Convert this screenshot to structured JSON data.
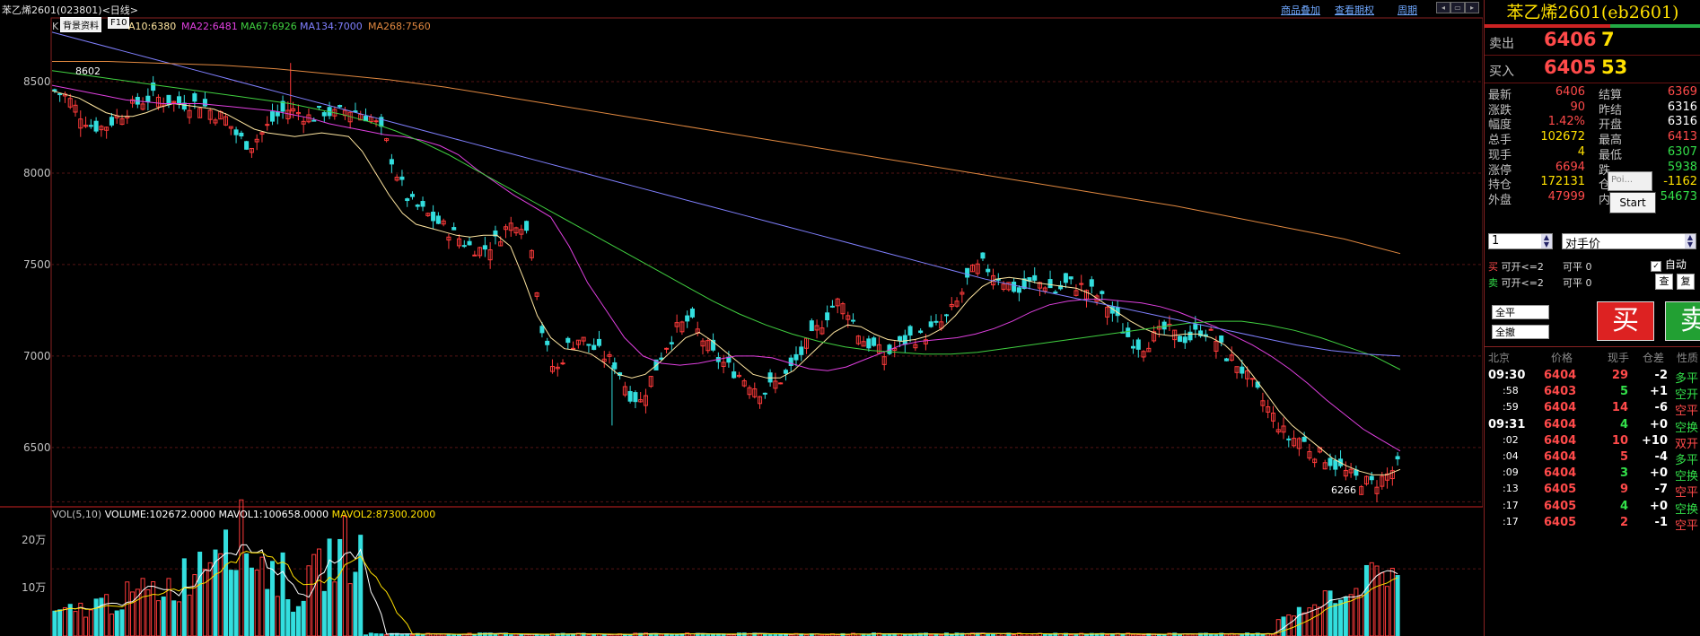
{
  "header": {
    "title": "苯乙烯2601(023801)<日线>",
    "links": [
      "商品叠加",
      "查看期权",
      "周期"
    ]
  },
  "chart_labels": {
    "k_prefix": "K",
    "buttons": [
      "背景资料",
      "F10"
    ],
    "ma": [
      {
        "text": "A10:6380",
        "color": "#ffe6a0"
      },
      {
        "text": "MA22:6481",
        "color": "#e040e0"
      },
      {
        "text": "MA67:6926",
        "color": "#40d040"
      },
      {
        "text": "MA134:7000",
        "color": "#8080ff"
      },
      {
        "text": "MA268:7560",
        "color": "#e08840"
      }
    ],
    "high_marker": "8602",
    "low_marker": "6266",
    "volume": {
      "prefix": "VOL(5,10)",
      "vol": "VOLUME:102672.0000",
      "mavol1": "MAVOL1:100658.0000",
      "mavol2": "MAVOL2:87300.2000",
      "ticks": [
        "20万",
        "10万"
      ]
    }
  },
  "chart_data": {
    "type": "candlestick",
    "price_ticks": [
      8500,
      8000,
      7500,
      7000,
      6500
    ],
    "ylim": [
      6200,
      8750
    ],
    "high": 8602,
    "low": 6266,
    "close_path": [
      8450,
      8420,
      8330,
      8260,
      8250,
      8300,
      8350,
      8390,
      8420,
      8400,
      8380,
      8380,
      8380,
      8330,
      8300,
      8200,
      8150,
      8220,
      8300,
      8350,
      8330,
      8300,
      8340,
      8320,
      8350,
      8330,
      8300,
      8200,
      8000,
      7850,
      7800,
      7750,
      7700,
      7650,
      7600,
      7580,
      7620,
      7700,
      7750,
      7650,
      7100,
      6900,
      7050,
      7100,
      7050,
      7000,
      6950,
      6800,
      6750,
      6900,
      7050,
      7150,
      7200,
      7100,
      7000,
      6950,
      6900,
      6850,
      6800,
      6850,
      6900,
      7000,
      7100,
      7200,
      7300,
      7250,
      7100,
      7050,
      7000,
      7050,
      7100,
      7100,
      7150,
      7200,
      7300,
      7450,
      7500,
      7450,
      7400,
      7350,
      7400,
      7400,
      7350,
      7400,
      7380,
      7350,
      7300,
      7200,
      7100,
      7050,
      7100,
      7150,
      7100,
      7100,
      7150,
      7100,
      7000,
      6950,
      6850,
      6750,
      6650,
      6550,
      6550,
      6480,
      6450,
      6400,
      6350,
      6320,
      6300,
      6340,
      6400
    ],
    "ma_series": [
      {
        "name": "MA10",
        "color": "#ffe6a0",
        "values": [
          8450,
          8430,
          8410,
          8370,
          8330,
          8310,
          8310,
          8330,
          8360,
          8380,
          8370,
          8360,
          8350,
          8320,
          8280,
          8240,
          8220,
          8210,
          8200,
          8210,
          8220,
          8210,
          8200,
          8120,
          8000,
          7880,
          7780,
          7720,
          7700,
          7680,
          7660,
          7650,
          7660,
          7660,
          7600,
          7420,
          7220,
          7100,
          7040,
          7030,
          7010,
          6960,
          6900,
          6880,
          6900,
          6960,
          7030,
          7100,
          7130,
          7080,
          7020,
          6960,
          6900,
          6880,
          6880,
          6920,
          6990,
          7060,
          7130,
          7170,
          7160,
          7120,
          7090,
          7080,
          7090,
          7110,
          7150,
          7220,
          7310,
          7380,
          7420,
          7430,
          7420,
          7400,
          7390,
          7380,
          7370,
          7340,
          7290,
          7240,
          7190,
          7150,
          7120,
          7110,
          7120,
          7120,
          7100,
          7060,
          6990,
          6900,
          6800,
          6700,
          6620,
          6560,
          6500,
          6440,
          6400,
          6370,
          6350,
          6350,
          6380
        ]
      },
      {
        "name": "MA22",
        "color": "#e040e0",
        "values": [
          8480,
          8460,
          8440,
          8420,
          8400,
          8390,
          8380,
          8380,
          8380,
          8370,
          8360,
          8350,
          8340,
          8320,
          8300,
          8270,
          8250,
          8230,
          8210,
          8200,
          8180,
          8150,
          8100,
          8020,
          7950,
          7880,
          7820,
          7760,
          7600,
          7400,
          7250,
          7100,
          7000,
          6960,
          6950,
          6960,
          6980,
          7000,
          7000,
          6990,
          6960,
          6930,
          6920,
          6940,
          6980,
          7020,
          7060,
          7080,
          7090,
          7100,
          7120,
          7150,
          7190,
          7240,
          7280,
          7300,
          7310,
          7310,
          7300,
          7290,
          7270,
          7240,
          7200,
          7160,
          7110,
          7060,
          7000,
          6930,
          6850,
          6760,
          6680,
          6600,
          6540,
          6481
        ]
      },
      {
        "name": "MA67",
        "color": "#40d040",
        "values": [
          8560,
          8540,
          8520,
          8500,
          8480,
          8460,
          8440,
          8420,
          8400,
          8380,
          8350,
          8320,
          8280,
          8230,
          8170,
          8100,
          8020,
          7940,
          7860,
          7780,
          7700,
          7620,
          7540,
          7460,
          7380,
          7300,
          7230,
          7170,
          7120,
          7080,
          7050,
          7030,
          7020,
          7010,
          7010,
          7020,
          7040,
          7060,
          7080,
          7100,
          7120,
          7140,
          7160,
          7180,
          7190,
          7190,
          7170,
          7140,
          7100,
          7050,
          7000,
          6926
        ]
      },
      {
        "name": "MA134",
        "color": "#8080ff",
        "values": [
          8770,
          8720,
          8670,
          8620,
          8570,
          8520,
          8470,
          8420,
          8370,
          8320,
          8270,
          8220,
          8170,
          8120,
          8070,
          8020,
          7970,
          7920,
          7870,
          7820,
          7770,
          7720,
          7670,
          7620,
          7570,
          7520,
          7470,
          7420,
          7380,
          7340,
          7300,
          7260,
          7220,
          7180,
          7140,
          7100,
          7060,
          7030,
          7010,
          7000
        ]
      },
      {
        "name": "MA268",
        "color": "#e08840",
        "values": [
          8610,
          8610,
          8600,
          8590,
          8570,
          8540,
          8510,
          8470,
          8420,
          8370,
          8320,
          8270,
          8220,
          8170,
          8120,
          8070,
          8020,
          7970,
          7920,
          7870,
          7820,
          7760,
          7700,
          7640,
          7560
        ]
      }
    ],
    "volume_ylim": [
      0,
      250000
    ],
    "volume_ticks": [
      200000,
      100000
    ]
  },
  "panel": {
    "title": "苯乙烯2601(eb2601)",
    "ask": {
      "label": "卖出",
      "price": "6406",
      "vol": "7"
    },
    "bid": {
      "label": "买入",
      "price": "6405",
      "vol": "53"
    },
    "quote": [
      {
        "l1": "最新",
        "v1": "6406",
        "c1": "red",
        "l2": "结算",
        "v2": "6369",
        "c2": "red"
      },
      {
        "l1": "涨跌",
        "v1": "90",
        "c1": "red",
        "l2": "昨结",
        "v2": "6316",
        "c2": "wht"
      },
      {
        "l1": "幅度",
        "v1": "1.42%",
        "c1": "red",
        "l2": "开盘",
        "v2": "6316",
        "c2": "wht"
      },
      {
        "l1": "总手",
        "v1": "102672",
        "c1": "yel",
        "l2": "最高",
        "v2": "6413",
        "c2": "red"
      },
      {
        "l1": "现手",
        "v1": "4",
        "c1": "yel",
        "l2": "最低",
        "v2": "6307",
        "c2": "grn"
      },
      {
        "l1": "涨停",
        "v1": "6694",
        "c1": "red",
        "l2": "跌",
        "v2": "5938",
        "c2": "grn"
      },
      {
        "l1": "持仓",
        "v1": "172131",
        "c1": "yel",
        "l2": "仓",
        "v2": "-1162",
        "c2": "yel"
      },
      {
        "l1": "外盘",
        "v1": "47999",
        "c1": "red",
        "l2": "内盘",
        "v2": "54673",
        "c2": "grn"
      }
    ],
    "popup_small": "Poi...",
    "popup_start": "Start",
    "order": {
      "qty": "1",
      "price_type": "对手价",
      "buy_label": "买",
      "buy_open": "可开<=2",
      "sell_label": "卖",
      "sell_open": "可开<=2",
      "close_label": "可平",
      "close_val": "0",
      "auto": "自动",
      "btn_check": "查",
      "btn_reset": "复",
      "close_all": "全平",
      "cancel_all": "全撤",
      "buy_btn": "买",
      "sell_btn": "卖"
    },
    "ticks_header": [
      "北京",
      "价格",
      "现手",
      "仓差",
      "性质"
    ],
    "ticks": [
      {
        "time": "09:30",
        "price": "6404",
        "vol": "29",
        "diff": "-2",
        "nature": "多平",
        "nc": "grn",
        "bold": true
      },
      {
        "time": ":58",
        "price": "6403",
        "vol": "5",
        "diff": "+1",
        "nature": "空开",
        "nc": "grn",
        "bold": false
      },
      {
        "time": ":59",
        "price": "6404",
        "vol": "14",
        "diff": "-6",
        "nature": "空平",
        "nc": "red",
        "bold": false
      },
      {
        "time": "09:31",
        "price": "6404",
        "vol": "4",
        "diff": "+0",
        "nature": "空换",
        "nc": "grn",
        "bold": true
      },
      {
        "time": ":02",
        "price": "6404",
        "vol": "10",
        "diff": "+10",
        "nature": "双开",
        "nc": "red",
        "bold": false
      },
      {
        "time": ":04",
        "price": "6404",
        "vol": "5",
        "diff": "-4",
        "nature": "多平",
        "nc": "grn",
        "bold": false
      },
      {
        "time": ":09",
        "price": "6404",
        "vol": "3",
        "diff": "+0",
        "nature": "空换",
        "nc": "grn",
        "bold": false
      },
      {
        "time": ":13",
        "price": "6405",
        "vol": "9",
        "diff": "-7",
        "nature": "空平",
        "nc": "red",
        "bold": false
      },
      {
        "time": ":17",
        "price": "6405",
        "vol": "4",
        "diff": "+0",
        "nature": "空换",
        "nc": "grn",
        "bold": false
      },
      {
        "time": ":17",
        "price": "6405",
        "vol": "2",
        "diff": "-1",
        "nature": "空平",
        "nc": "red",
        "bold": false
      }
    ]
  }
}
